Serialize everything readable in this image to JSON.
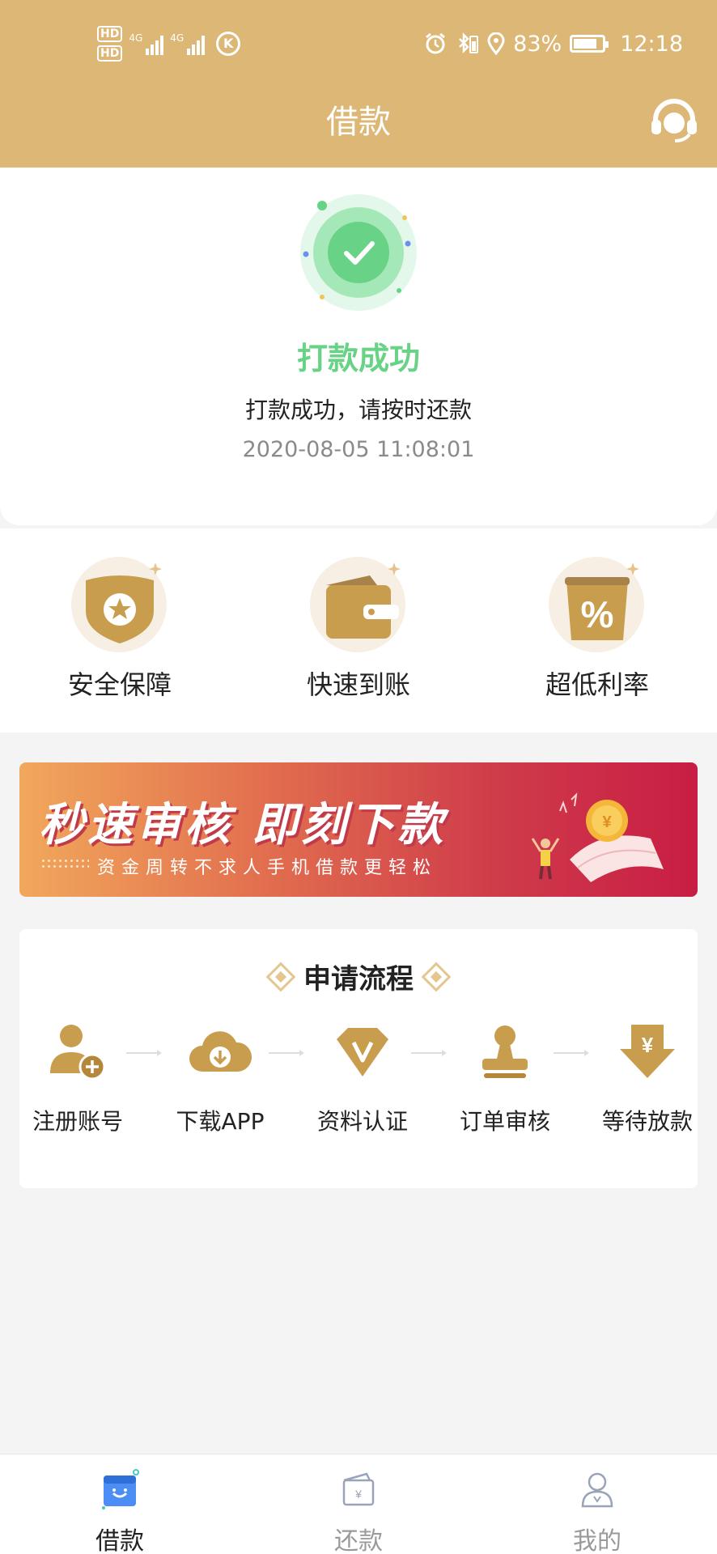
{
  "status_bar": {
    "hd1": "HD",
    "hd2": "HD",
    "net1": "4G",
    "net2": "4G",
    "k_badge": "K",
    "battery": "83%",
    "battery_level": 0.83,
    "time": "12:18"
  },
  "header": {
    "title": "借款",
    "service_icon": "customer-service-headset-icon"
  },
  "result": {
    "icon": "check-icon",
    "title": "打款成功",
    "message": "打款成功，请按时还款",
    "timestamp": "2020-08-05 11:08:01",
    "color": "#68d386"
  },
  "features": [
    {
      "label": "安全保障",
      "icon": "shield-icon"
    },
    {
      "label": "快速到账",
      "icon": "wallet-icon"
    },
    {
      "label": "超低利率",
      "icon": "percent-icon"
    }
  ],
  "banner": {
    "title": "秒速审核 即刻下款",
    "subtitle": "资金周转不求人手机借款更轻松"
  },
  "process": {
    "title": "申请流程",
    "steps": [
      {
        "label": "注册账号",
        "icon": "user-add-icon"
      },
      {
        "label": "下载APP",
        "icon": "cloud-download-icon"
      },
      {
        "label": "资料认证",
        "icon": "verified-icon"
      },
      {
        "label": "订单审核",
        "icon": "stamp-icon"
      },
      {
        "label": "等待放款",
        "icon": "yuan-arrow-icon"
      }
    ]
  },
  "tabbar": {
    "items": [
      {
        "label": "借款",
        "icon": "loan-icon",
        "active": true
      },
      {
        "label": "还款",
        "icon": "repay-icon",
        "active": false
      },
      {
        "label": "我的",
        "icon": "profile-icon",
        "active": false
      }
    ]
  },
  "colors": {
    "brand": "#dcb775",
    "gold": "#c89e4e",
    "success": "#68d386",
    "background": "#f4f4f4"
  }
}
